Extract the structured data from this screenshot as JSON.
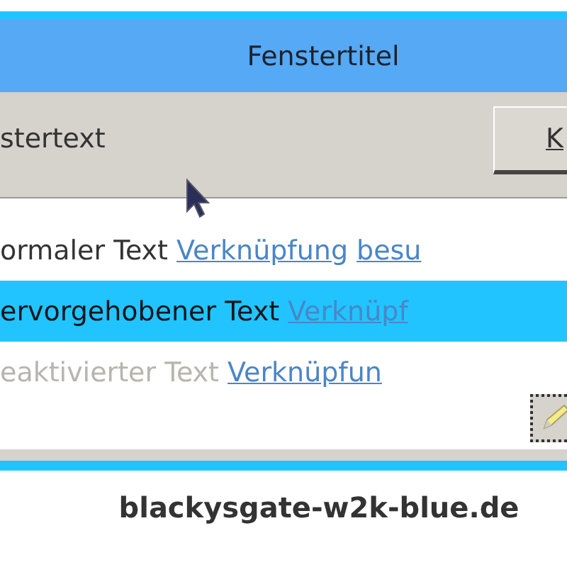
{
  "window": {
    "title": "Fenstertitel"
  },
  "panel": {
    "text": "stertext",
    "button": "K"
  },
  "lines": [
    {
      "text": "ormaler Text",
      "selected": false,
      "disabled": false,
      "links": [
        "Verknüpfung",
        "besu"
      ]
    },
    {
      "text": "ervorgehobener Text",
      "selected": true,
      "disabled": false,
      "links": [
        "Verknüpf"
      ]
    },
    {
      "text": "eaktivierter Text",
      "selected": false,
      "disabled": true,
      "links": [
        "Verknüpfun"
      ]
    }
  ],
  "caption": "blackysgate-w2k-blue.de"
}
